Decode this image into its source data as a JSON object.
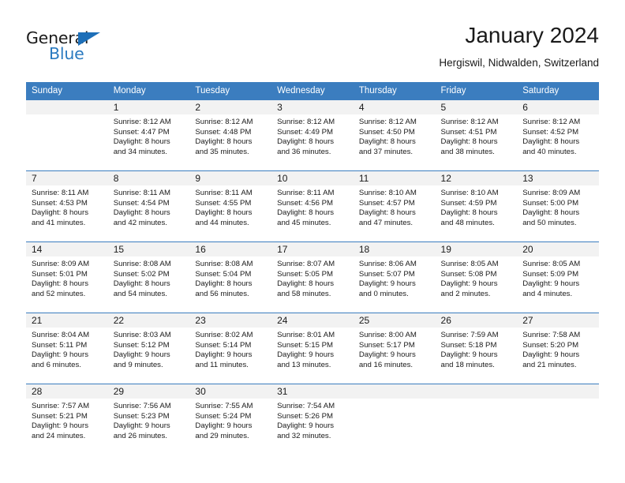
{
  "brand": {
    "word_one": "General",
    "word_two": "Blue",
    "triangle_icon": "triangle-icon"
  },
  "header": {
    "title": "January 2024",
    "subtitle": "Hergiswil, Nidwalden, Switzerland"
  },
  "colors": {
    "header_blue": "#3b7dbf",
    "brand_blue": "#2a7ac0",
    "daynum_band": "#f2f2f2",
    "text": "#1a1a1a"
  },
  "weekday_headers": [
    "Sunday",
    "Monday",
    "Tuesday",
    "Wednesday",
    "Thursday",
    "Friday",
    "Saturday"
  ],
  "labels": {
    "sunrise_prefix": "Sunrise:",
    "sunset_prefix": "Sunset:",
    "daylight_prefix": "Daylight:"
  },
  "weeks": [
    [
      {
        "day": "",
        "sunrise": "",
        "sunset": "",
        "daylight_line1": "",
        "daylight_line2": ""
      },
      {
        "day": "1",
        "sunrise": "Sunrise: 8:12 AM",
        "sunset": "Sunset: 4:47 PM",
        "daylight_line1": "Daylight: 8 hours",
        "daylight_line2": "and 34 minutes."
      },
      {
        "day": "2",
        "sunrise": "Sunrise: 8:12 AM",
        "sunset": "Sunset: 4:48 PM",
        "daylight_line1": "Daylight: 8 hours",
        "daylight_line2": "and 35 minutes."
      },
      {
        "day": "3",
        "sunrise": "Sunrise: 8:12 AM",
        "sunset": "Sunset: 4:49 PM",
        "daylight_line1": "Daylight: 8 hours",
        "daylight_line2": "and 36 minutes."
      },
      {
        "day": "4",
        "sunrise": "Sunrise: 8:12 AM",
        "sunset": "Sunset: 4:50 PM",
        "daylight_line1": "Daylight: 8 hours",
        "daylight_line2": "and 37 minutes."
      },
      {
        "day": "5",
        "sunrise": "Sunrise: 8:12 AM",
        "sunset": "Sunset: 4:51 PM",
        "daylight_line1": "Daylight: 8 hours",
        "daylight_line2": "and 38 minutes."
      },
      {
        "day": "6",
        "sunrise": "Sunrise: 8:12 AM",
        "sunset": "Sunset: 4:52 PM",
        "daylight_line1": "Daylight: 8 hours",
        "daylight_line2": "and 40 minutes."
      }
    ],
    [
      {
        "day": "7",
        "sunrise": "Sunrise: 8:11 AM",
        "sunset": "Sunset: 4:53 PM",
        "daylight_line1": "Daylight: 8 hours",
        "daylight_line2": "and 41 minutes."
      },
      {
        "day": "8",
        "sunrise": "Sunrise: 8:11 AM",
        "sunset": "Sunset: 4:54 PM",
        "daylight_line1": "Daylight: 8 hours",
        "daylight_line2": "and 42 minutes."
      },
      {
        "day": "9",
        "sunrise": "Sunrise: 8:11 AM",
        "sunset": "Sunset: 4:55 PM",
        "daylight_line1": "Daylight: 8 hours",
        "daylight_line2": "and 44 minutes."
      },
      {
        "day": "10",
        "sunrise": "Sunrise: 8:11 AM",
        "sunset": "Sunset: 4:56 PM",
        "daylight_line1": "Daylight: 8 hours",
        "daylight_line2": "and 45 minutes."
      },
      {
        "day": "11",
        "sunrise": "Sunrise: 8:10 AM",
        "sunset": "Sunset: 4:57 PM",
        "daylight_line1": "Daylight: 8 hours",
        "daylight_line2": "and 47 minutes."
      },
      {
        "day": "12",
        "sunrise": "Sunrise: 8:10 AM",
        "sunset": "Sunset: 4:59 PM",
        "daylight_line1": "Daylight: 8 hours",
        "daylight_line2": "and 48 minutes."
      },
      {
        "day": "13",
        "sunrise": "Sunrise: 8:09 AM",
        "sunset": "Sunset: 5:00 PM",
        "daylight_line1": "Daylight: 8 hours",
        "daylight_line2": "and 50 minutes."
      }
    ],
    [
      {
        "day": "14",
        "sunrise": "Sunrise: 8:09 AM",
        "sunset": "Sunset: 5:01 PM",
        "daylight_line1": "Daylight: 8 hours",
        "daylight_line2": "and 52 minutes."
      },
      {
        "day": "15",
        "sunrise": "Sunrise: 8:08 AM",
        "sunset": "Sunset: 5:02 PM",
        "daylight_line1": "Daylight: 8 hours",
        "daylight_line2": "and 54 minutes."
      },
      {
        "day": "16",
        "sunrise": "Sunrise: 8:08 AM",
        "sunset": "Sunset: 5:04 PM",
        "daylight_line1": "Daylight: 8 hours",
        "daylight_line2": "and 56 minutes."
      },
      {
        "day": "17",
        "sunrise": "Sunrise: 8:07 AM",
        "sunset": "Sunset: 5:05 PM",
        "daylight_line1": "Daylight: 8 hours",
        "daylight_line2": "and 58 minutes."
      },
      {
        "day": "18",
        "sunrise": "Sunrise: 8:06 AM",
        "sunset": "Sunset: 5:07 PM",
        "daylight_line1": "Daylight: 9 hours",
        "daylight_line2": "and 0 minutes."
      },
      {
        "day": "19",
        "sunrise": "Sunrise: 8:05 AM",
        "sunset": "Sunset: 5:08 PM",
        "daylight_line1": "Daylight: 9 hours",
        "daylight_line2": "and 2 minutes."
      },
      {
        "day": "20",
        "sunrise": "Sunrise: 8:05 AM",
        "sunset": "Sunset: 5:09 PM",
        "daylight_line1": "Daylight: 9 hours",
        "daylight_line2": "and 4 minutes."
      }
    ],
    [
      {
        "day": "21",
        "sunrise": "Sunrise: 8:04 AM",
        "sunset": "Sunset: 5:11 PM",
        "daylight_line1": "Daylight: 9 hours",
        "daylight_line2": "and 6 minutes."
      },
      {
        "day": "22",
        "sunrise": "Sunrise: 8:03 AM",
        "sunset": "Sunset: 5:12 PM",
        "daylight_line1": "Daylight: 9 hours",
        "daylight_line2": "and 9 minutes."
      },
      {
        "day": "23",
        "sunrise": "Sunrise: 8:02 AM",
        "sunset": "Sunset: 5:14 PM",
        "daylight_line1": "Daylight: 9 hours",
        "daylight_line2": "and 11 minutes."
      },
      {
        "day": "24",
        "sunrise": "Sunrise: 8:01 AM",
        "sunset": "Sunset: 5:15 PM",
        "daylight_line1": "Daylight: 9 hours",
        "daylight_line2": "and 13 minutes."
      },
      {
        "day": "25",
        "sunrise": "Sunrise: 8:00 AM",
        "sunset": "Sunset: 5:17 PM",
        "daylight_line1": "Daylight: 9 hours",
        "daylight_line2": "and 16 minutes."
      },
      {
        "day": "26",
        "sunrise": "Sunrise: 7:59 AM",
        "sunset": "Sunset: 5:18 PM",
        "daylight_line1": "Daylight: 9 hours",
        "daylight_line2": "and 18 minutes."
      },
      {
        "day": "27",
        "sunrise": "Sunrise: 7:58 AM",
        "sunset": "Sunset: 5:20 PM",
        "daylight_line1": "Daylight: 9 hours",
        "daylight_line2": "and 21 minutes."
      }
    ],
    [
      {
        "day": "28",
        "sunrise": "Sunrise: 7:57 AM",
        "sunset": "Sunset: 5:21 PM",
        "daylight_line1": "Daylight: 9 hours",
        "daylight_line2": "and 24 minutes."
      },
      {
        "day": "29",
        "sunrise": "Sunrise: 7:56 AM",
        "sunset": "Sunset: 5:23 PM",
        "daylight_line1": "Daylight: 9 hours",
        "daylight_line2": "and 26 minutes."
      },
      {
        "day": "30",
        "sunrise": "Sunrise: 7:55 AM",
        "sunset": "Sunset: 5:24 PM",
        "daylight_line1": "Daylight: 9 hours",
        "daylight_line2": "and 29 minutes."
      },
      {
        "day": "31",
        "sunrise": "Sunrise: 7:54 AM",
        "sunset": "Sunset: 5:26 PM",
        "daylight_line1": "Daylight: 9 hours",
        "daylight_line2": "and 32 minutes."
      },
      {
        "day": "",
        "sunrise": "",
        "sunset": "",
        "daylight_line1": "",
        "daylight_line2": ""
      },
      {
        "day": "",
        "sunrise": "",
        "sunset": "",
        "daylight_line1": "",
        "daylight_line2": ""
      },
      {
        "day": "",
        "sunrise": "",
        "sunset": "",
        "daylight_line1": "",
        "daylight_line2": ""
      }
    ]
  ]
}
